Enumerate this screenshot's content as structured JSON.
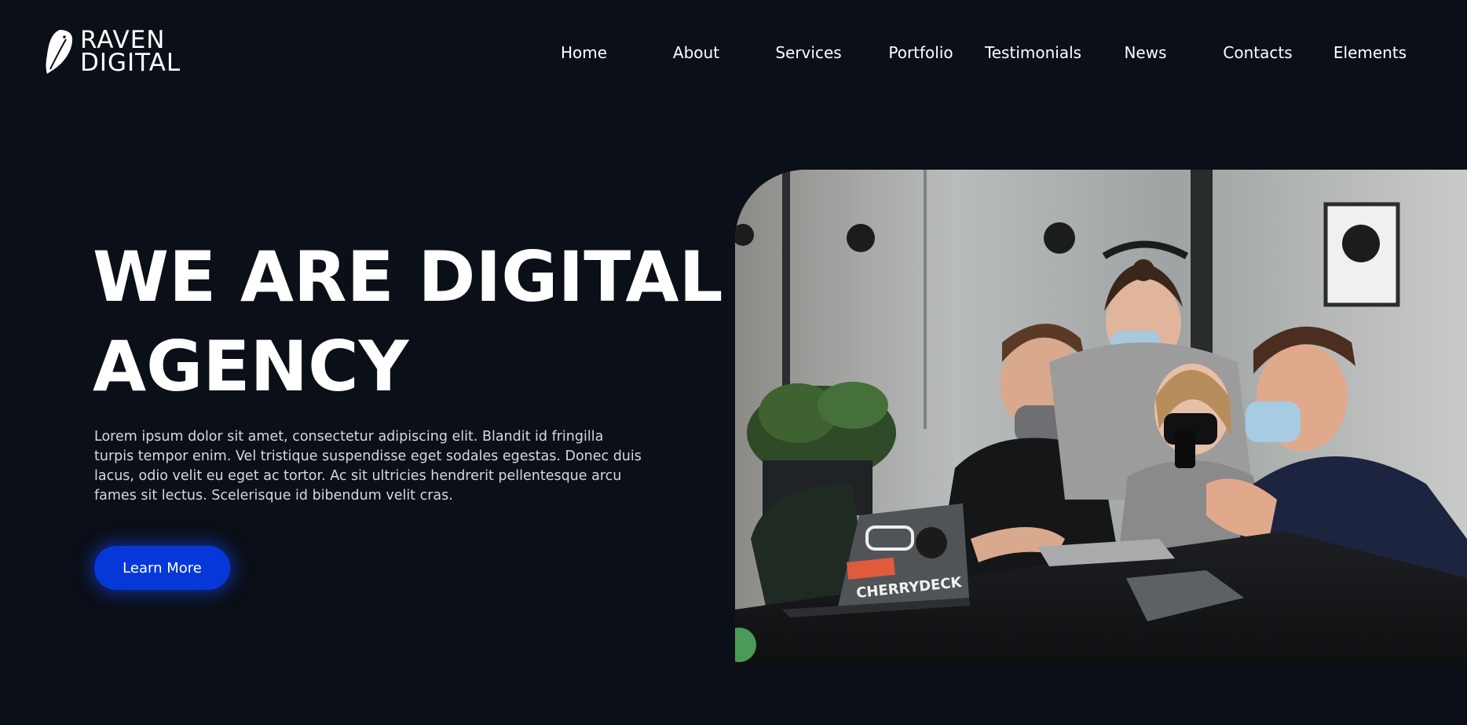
{
  "brand": {
    "line1": "RAVEN",
    "line2": "DIGITAL",
    "icon": "raven-feather-icon"
  },
  "nav": {
    "items": [
      {
        "label": "Home"
      },
      {
        "label": "About"
      },
      {
        "label": "Services"
      },
      {
        "label": "Portfolio"
      },
      {
        "label": "Testimonials"
      },
      {
        "label": "News"
      },
      {
        "label": "Contacts"
      },
      {
        "label": "Elements"
      }
    ]
  },
  "hero": {
    "title_line1": "WE ARE DIGITAL",
    "title_line2": "AGENCY",
    "text": "Lorem ipsum dolor sit amet, consectetur adipiscing elit. Blandit id fringilla turpis tempor enim. Vel tristique suspendisse eget sodales egestas. Donec duis lacus, odio velit eu eget ac tortor. Ac sit ultricies hendrerit pellentesque arcu fames sit lectus. Scelerisque id bibendum velit cras.",
    "cta_label": "Learn More",
    "image_alt": "Team of four people in face masks gathered around a table with laptops looking at a phone",
    "laptop_sticker": "CHERRYDECK"
  },
  "colors": {
    "background": "#0b0f17",
    "accent": "#0638d9",
    "text": "#ffffff",
    "body_text": "#d6d9df"
  }
}
